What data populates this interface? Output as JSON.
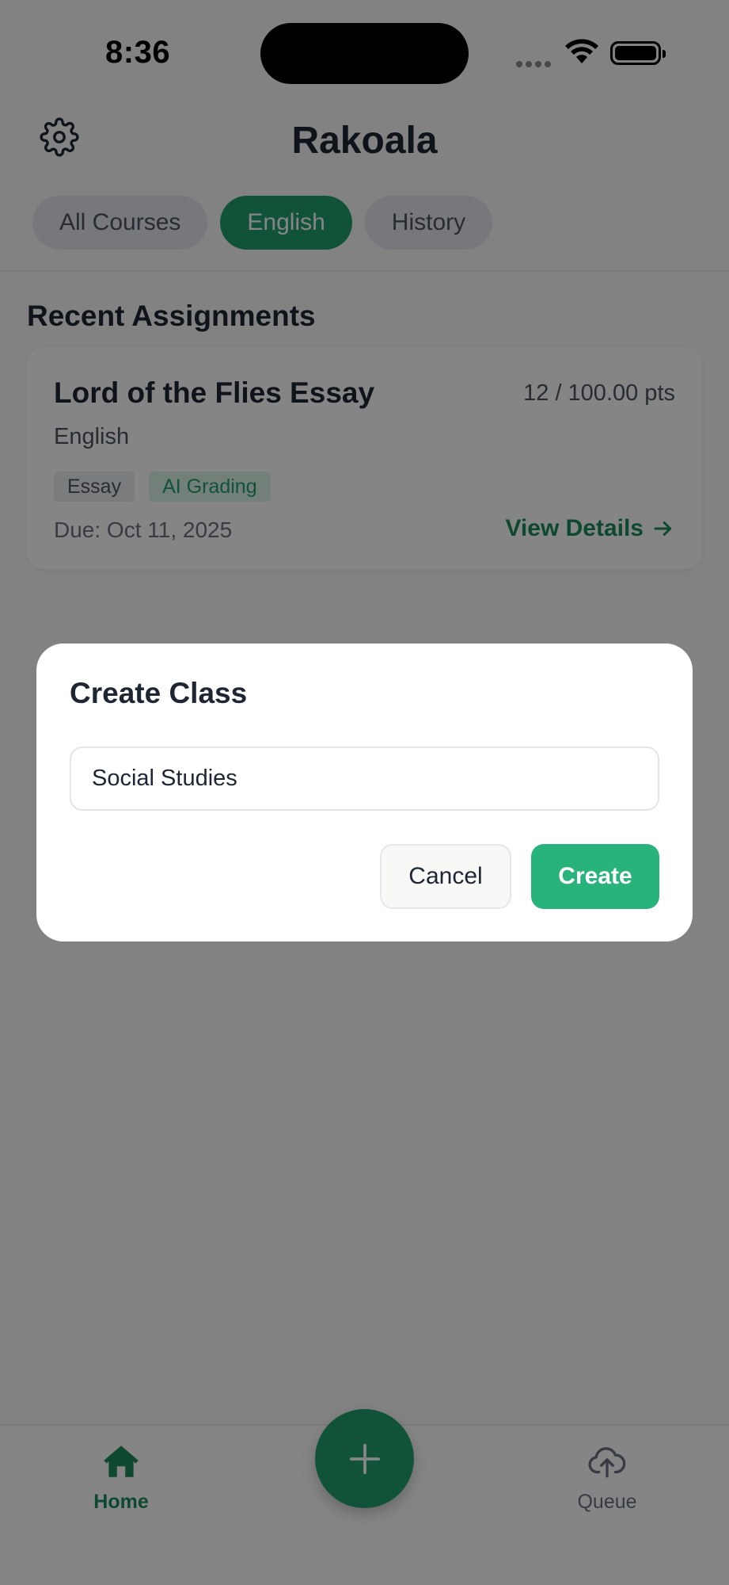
{
  "status_bar": {
    "time": "8:36"
  },
  "header": {
    "title": "Rakoala",
    "settings_icon": "gear-icon"
  },
  "tabs": [
    {
      "label": "All Courses",
      "active": false
    },
    {
      "label": "English",
      "active": true
    },
    {
      "label": "History",
      "active": false
    }
  ],
  "section": {
    "title": "Recent Assignments"
  },
  "assignment": {
    "title": "Lord of the Flies Essay",
    "points": "12 / 100.00 pts",
    "course": "English",
    "tags": [
      "Essay",
      "AI Grading"
    ],
    "due": "Due: Oct 11, 2025",
    "action_label": "View Details"
  },
  "bottom_nav": {
    "home_label": "Home",
    "queue_label": "Queue",
    "fab_icon": "plus-icon"
  },
  "dialog": {
    "title": "Create Class",
    "input_value": "Social Studies",
    "cancel_label": "Cancel",
    "create_label": "Create"
  },
  "colors": {
    "accent": "#22a06b",
    "accent_dark": "#1a8a5a",
    "create_button": "#27b37a",
    "overlay": "rgba(0,0,0,0.48)"
  }
}
